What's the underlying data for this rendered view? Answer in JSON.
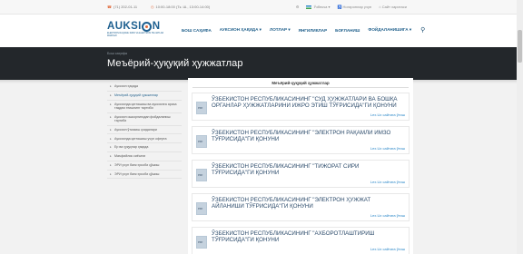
{
  "topbar": {
    "phone": "(71) 202-01-11",
    "hours": "10:00-18:00 (Тк. Ш., 13:00-14:00)",
    "lang": "Ўзбекча",
    "site_map": "Ногиронлар учун",
    "visually_impaired": "Сайт хaритаси"
  },
  "logo": {
    "word_left": "AUKSI",
    "word_right": "N",
    "subtitle": "ELEKTRON RAQAMLI IMZO VA ELEKTRON HUJJATLAR MARKAZI"
  },
  "nav": [
    {
      "label": "Бош саҳифа"
    },
    {
      "label": "Ауксион ҳақида ▾"
    },
    {
      "label": "Лотлар ▾"
    },
    {
      "label": "Янгиликлар"
    },
    {
      "label": "Боғланиш"
    },
    {
      "label": "Фойдаланишига ▾"
    }
  ],
  "banner": {
    "breadcrumb": "Бош саҳифа",
    "title": "Меъёрий-ҳуқуқий ҳужжатлар"
  },
  "sidebar": [
    {
      "label": "Ауксион ҳақида",
      "active": false
    },
    {
      "label": "Меъёрий-ҳуқуқий ҳужжатлар",
      "active": true
    },
    {
      "label": "Ауксионда қатнашиш ва ауксионга ариза тақдим этишнинг тартиби",
      "active": false
    },
    {
      "label": "Ауксион ошкорлигидан фойдаланиш тартиби",
      "active": false
    },
    {
      "label": "Ауксион ўтказиш қоидалари",
      "active": false
    },
    {
      "label": "Ауксионда қатнашиш учун оферта",
      "active": false
    },
    {
      "label": "Ер ва ҳуқуқлар ҳақида",
      "active": false
    },
    {
      "label": "Маъфийлик сиёсати",
      "active": false
    },
    {
      "label": "ЭРИ учун банк ҳисоби қўшиш",
      "active": false
    },
    {
      "label": "ЭРИ учун банк ҳисоби қўшиш",
      "active": false
    }
  ],
  "main": {
    "title": "Меъёрий-ҳуқуқий ҳужжатлар",
    "link_label": "Lex.Uz сайтига ўтиш",
    "docs": [
      {
        "title": "Ўзбекистон Республикасининг \"Суд ҳужжатлари ва бошқа органлар ҳужжатларини ижро этиш тўғрисида\"ги қонуни"
      },
      {
        "title": "Ўзбекистон Республикасининг \"Электрон рақамли имзо тўғрисида\"ги қонуни"
      },
      {
        "title": "Ўзбекистон Республикасининг \"Тижорат сири тўғрисида\"ги қонуни"
      },
      {
        "title": "Ўзбекистон Республикасининг \"Электрон ҳужжат айланиши тўғрисида\"ги қонуни"
      },
      {
        "title": "Ўзбекистон Республикасининг \"Ахборотлаштириш тўғрисида\"ги қонуни"
      }
    ]
  },
  "colors": {
    "brand": "#1d5f8f",
    "accent": "#e0693a",
    "link": "#2a87c8",
    "banner": "#23272b"
  },
  "icons": {
    "phone": "phone-icon",
    "clock": "clock-icon",
    "search": "search-icon",
    "document": "document-icon"
  }
}
